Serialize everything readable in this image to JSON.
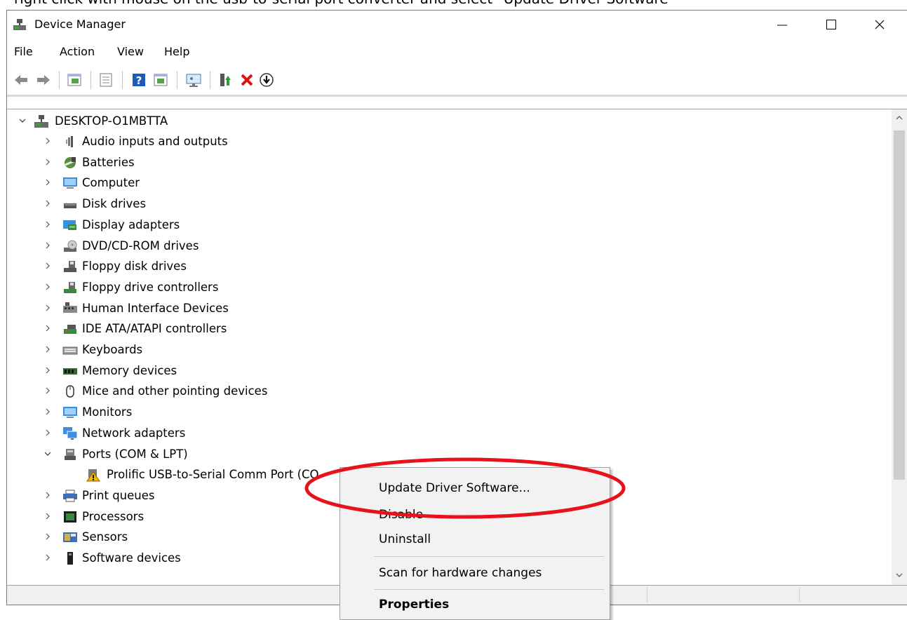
{
  "instruction": "right click with mouse on the usb-to-serial port converter and select \"Update Driver Software\"",
  "window": {
    "title": "Device Manager"
  },
  "menubar": {
    "items": [
      "File",
      "Action",
      "View",
      "Help"
    ]
  },
  "tree": {
    "root": "DESKTOP-O1MBTTA",
    "categories": [
      {
        "label": "Audio inputs and outputs",
        "icon": "speaker-icon"
      },
      {
        "label": "Batteries",
        "icon": "battery-icon"
      },
      {
        "label": "Computer",
        "icon": "computer-icon"
      },
      {
        "label": "Disk drives",
        "icon": "disk-drive-icon"
      },
      {
        "label": "Display adapters",
        "icon": "display-adapter-icon"
      },
      {
        "label": "DVD/CD-ROM drives",
        "icon": "dvd-drive-icon"
      },
      {
        "label": "Floppy disk drives",
        "icon": "floppy-drive-icon"
      },
      {
        "label": "Floppy drive controllers",
        "icon": "floppy-controller-icon"
      },
      {
        "label": "Human Interface Devices",
        "icon": "hid-icon"
      },
      {
        "label": "IDE ATA/ATAPI controllers",
        "icon": "ide-controller-icon"
      },
      {
        "label": "Keyboards",
        "icon": "keyboard-icon"
      },
      {
        "label": "Memory devices",
        "icon": "memory-icon"
      },
      {
        "label": "Mice and other pointing devices",
        "icon": "mouse-icon"
      },
      {
        "label": "Monitors",
        "icon": "monitor-icon"
      },
      {
        "label": "Network adapters",
        "icon": "network-adapter-icon"
      },
      {
        "label": "Ports (COM & LPT)",
        "icon": "port-icon",
        "expanded": true
      },
      {
        "label": "Prolific USB-to-Serial Comm Port (CO",
        "icon": "warning-device-icon",
        "child": true
      },
      {
        "label": "Print queues",
        "icon": "printer-icon"
      },
      {
        "label": "Processors",
        "icon": "processor-icon"
      },
      {
        "label": "Sensors",
        "icon": "sensor-icon"
      },
      {
        "label": "Software devices",
        "icon": "software-device-icon"
      }
    ]
  },
  "context_menu": {
    "items": [
      "Update Driver Software...",
      "Disable",
      "Uninstall",
      "Scan for hardware changes",
      "Properties"
    ]
  },
  "colors": {
    "highlight_ellipse": "#e8121c",
    "warning": "#f2b600",
    "accent": "#2d7fd3"
  }
}
